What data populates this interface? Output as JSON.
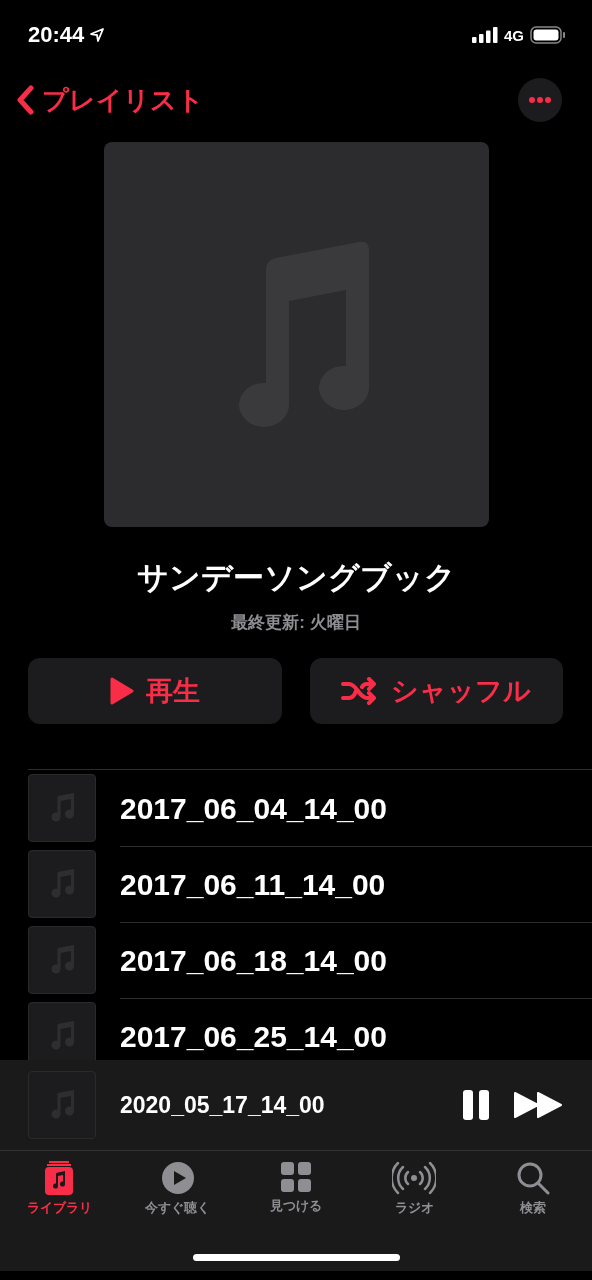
{
  "status_bar": {
    "time": "20:44",
    "network": "4G"
  },
  "nav": {
    "back_label": "プレイリスト"
  },
  "playlist": {
    "title": "サンデーソングブック",
    "updated": "最終更新: 火曜日"
  },
  "actions": [
    {
      "kind": "play",
      "label": "再生"
    },
    {
      "kind": "shuffle",
      "label": "シャッフル"
    }
  ],
  "tracks": [
    {
      "title": "2017_06_04_14_00"
    },
    {
      "title": "2017_06_11_14_00"
    },
    {
      "title": "2017_06_18_14_00"
    },
    {
      "title": "2017_06_25_14_00"
    }
  ],
  "mini_player": {
    "title": "2020_05_17_14_00"
  },
  "tabs": [
    {
      "kind": "library",
      "label": "ライブラリ",
      "selected": true
    },
    {
      "kind": "listen",
      "label": "今すぐ聴く",
      "selected": false
    },
    {
      "kind": "browse",
      "label": "見つける",
      "selected": false
    },
    {
      "kind": "radio",
      "label": "ラジオ",
      "selected": false
    },
    {
      "kind": "search",
      "label": "検索",
      "selected": false
    }
  ]
}
